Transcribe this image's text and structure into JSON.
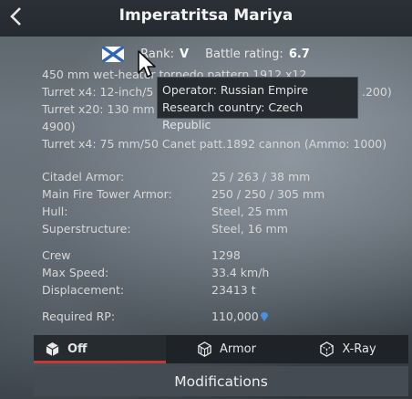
{
  "header": {
    "title": "Imperatritsa Mariya",
    "back_icon": "chevron-left-icon"
  },
  "info": {
    "rank_label": "Rank:",
    "rank_value": "V",
    "br_label": "Battle rating:",
    "br_value": "6.7",
    "flag_icon": "naval-ensign-flag-icon"
  },
  "armament": [
    "450 mm wet-heater torpedo pattern 1912 x12",
    "Turret x4: 12-inch/5",
    ".200)",
    "Turret x20: 130 mm",
    "4900)",
    "Turret x4: 75 mm/50 Canet patt.1892 cannon (Ammo: 1000)"
  ],
  "tooltip": {
    "operator": "Operator: Russian Empire",
    "research": "Research country: Czech Republic"
  },
  "armor": [
    {
      "label": "Citadel Armor:",
      "value": "25 / 263 / 38 mm"
    },
    {
      "label": "Main Fire Tower Armor:",
      "value": "250 / 250 / 305 mm"
    },
    {
      "label": "Hull:",
      "value": "Steel, 25 mm"
    },
    {
      "label": "Superstructure:",
      "value": "Steel, 16 mm"
    }
  ],
  "specs": [
    {
      "label": "Crew",
      "value": "1298"
    },
    {
      "label": "Max Speed:",
      "value": "33.4 km/h"
    },
    {
      "label": "Displacement:",
      "value": "23413 t"
    }
  ],
  "rp": {
    "label": "Required RP:",
    "value": "110,000",
    "icon": "research-point-icon"
  },
  "tabs": [
    {
      "label": "Off",
      "icon": "cube-icon",
      "active": true
    },
    {
      "label": "Armor",
      "icon": "armor-cube-icon",
      "active": false
    },
    {
      "label": "X-Ray",
      "icon": "xray-cube-icon",
      "active": false
    }
  ],
  "modifications_label": "Modifications",
  "colors": {
    "accent_underline": "#c23c34",
    "rp_icon": "#4a8fe0"
  }
}
